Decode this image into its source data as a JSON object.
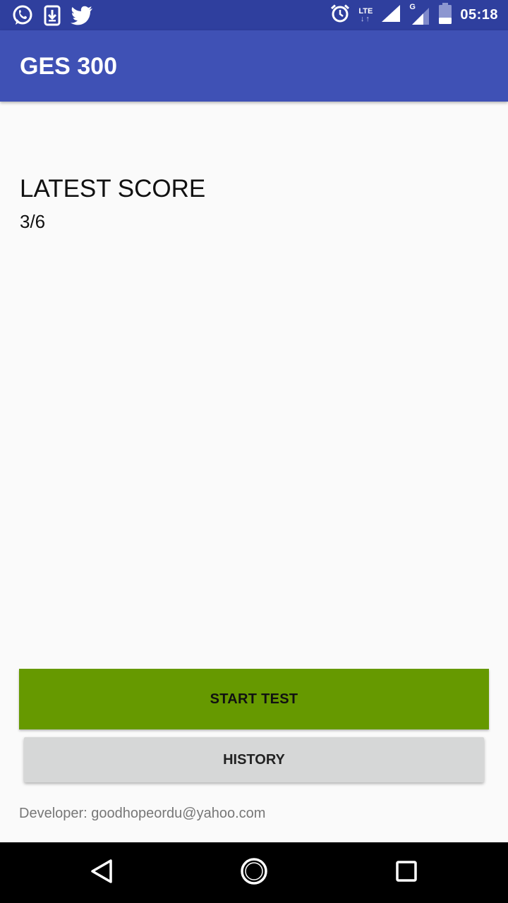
{
  "status_bar": {
    "icons_left": [
      "whatsapp-icon",
      "download-icon",
      "twitter-icon"
    ],
    "icons_right": [
      "alarm-icon",
      "lte-signal-icon",
      "signal-icon",
      "g-signal-icon",
      "battery-icon"
    ],
    "lte_label": "LTE",
    "lte_arrows": "↓↑",
    "g_label": "G",
    "time": "05:18",
    "color": "#2f3f9e"
  },
  "app_bar": {
    "title": "GES 300",
    "color": "#3f51b5"
  },
  "main": {
    "score_label": "LATEST SCORE",
    "score_value": "3/6",
    "start_button": "START TEST",
    "start_button_color": "#669900",
    "history_button": "HISTORY",
    "developer": "Developer: goodhopeordu@yahoo.com"
  },
  "nav_bar": {
    "icons": [
      "back-icon",
      "home-icon",
      "recents-icon"
    ]
  }
}
